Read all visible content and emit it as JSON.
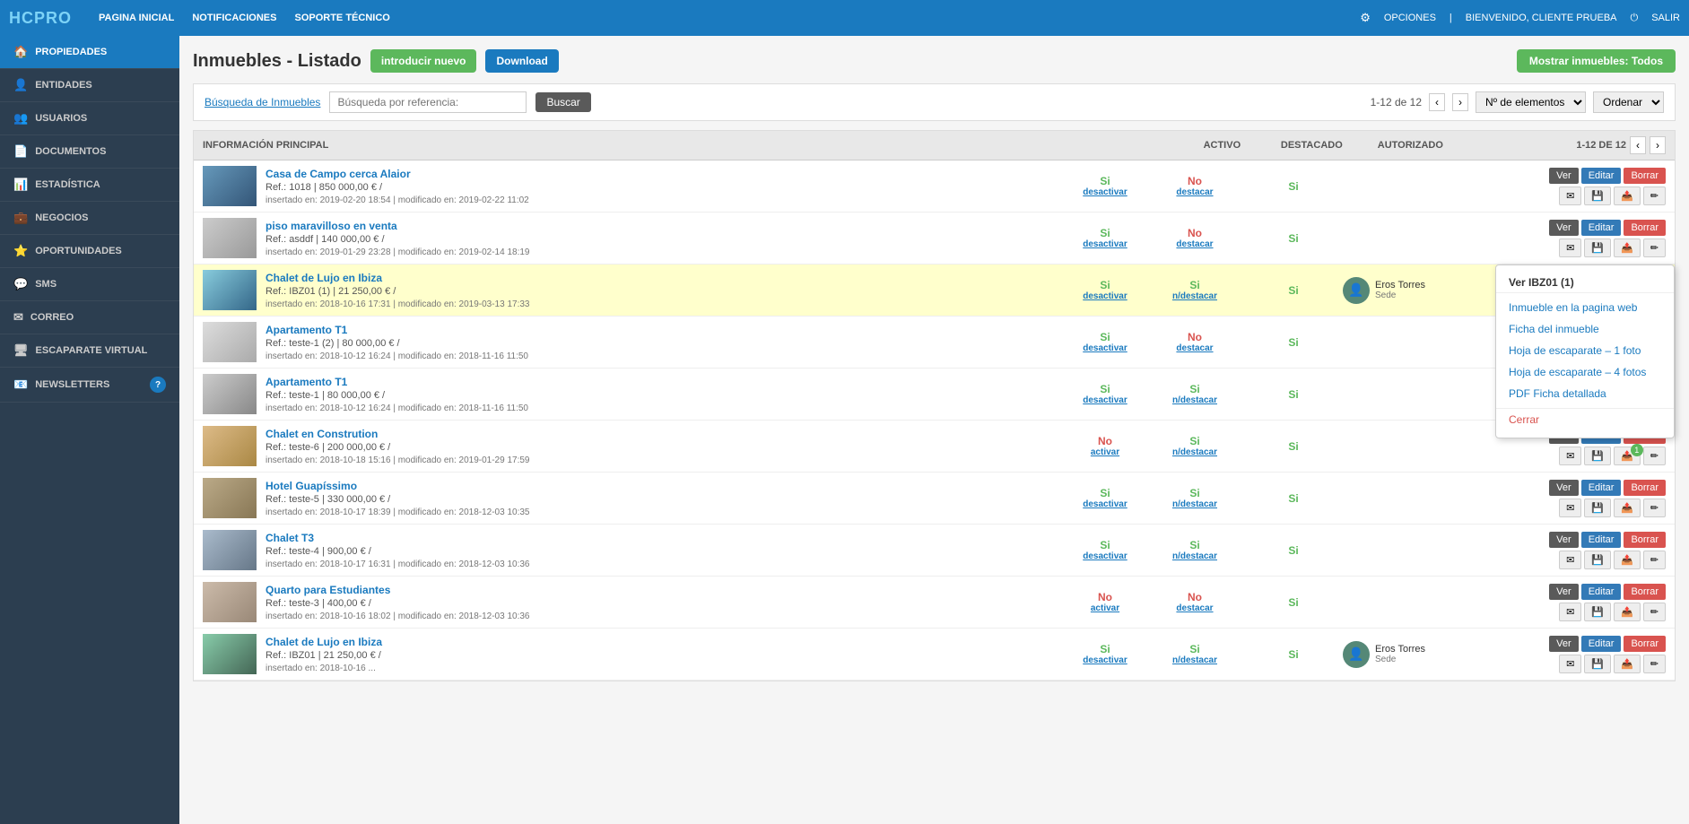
{
  "topnav": {
    "logo_hc": "HC",
    "logo_pro": "PRO",
    "links": [
      "PAGINA INICIAL",
      "NOTIFICACIONES",
      "SOPORTE TÉCNICO"
    ],
    "opciones": "OPCIONES",
    "bienvenido": "BIENVENIDO, CLIENTE PRUEBA",
    "salir": "SALIR"
  },
  "sidebar": {
    "items": [
      {
        "label": "PROPIEDADES",
        "icon": "🏠",
        "active": true
      },
      {
        "label": "ENTIDADES",
        "icon": "👤"
      },
      {
        "label": "USUARIOS",
        "icon": "👥"
      },
      {
        "label": "DOCUMENTOS",
        "icon": "📄"
      },
      {
        "label": "ESTADÍSTICA",
        "icon": "📊"
      },
      {
        "label": "NEGOCIOS",
        "icon": "💼"
      },
      {
        "label": "OPORTUNIDADES",
        "icon": "⭐"
      },
      {
        "label": "SMS",
        "icon": "💬"
      },
      {
        "label": "CORREO",
        "icon": "✉"
      },
      {
        "label": "ESCAPARATE VIRTUAL",
        "icon": "🖥"
      },
      {
        "label": "NEWSLETTERS",
        "icon": "📧",
        "badge": "?"
      }
    ]
  },
  "page": {
    "title": "Inmuebles - Listado",
    "btn_nuevo": "introducir nuevo",
    "btn_download": "Download",
    "btn_mostrar": "Mostrar inmuebles: Todos"
  },
  "search": {
    "link_label": "Búsqueda de Inmuebles",
    "input_placeholder": "Búsqueda por referencia:",
    "btn_buscar": "Buscar",
    "pagination_info": "1-12 de 12",
    "elements_label": "Nº de elementos",
    "order_label": "Ordenar"
  },
  "table": {
    "headers": {
      "info": "INFORMACIÓN PRINCIPAL",
      "activo": "ACTIVO",
      "destacado": "DESTACADO",
      "autorizado": "AUTORIZADO"
    },
    "pagination_top": "1-12 de 12",
    "rows": [
      {
        "name": "Casa de Campo cerca Alaior",
        "ref": "Ref.: 1018 | 850 000,00 € /",
        "date": "insertado en: 2019-02-20 18:54 | modificado en: 2019-02-22 11:02",
        "activo": "Si",
        "activo_link": "desactivar",
        "destacado": "No",
        "destacado_link": "destacar",
        "autorizado": "Si",
        "agent": null,
        "color": "blue",
        "highlighted": false
      },
      {
        "name": "piso maravilloso en venta",
        "ref": "Ref.: asddf | 140 000,00 € /",
        "date": "insertado en: 2019-01-29 23:28 | modificado en: 2019-02-14 18:19",
        "activo": "Si",
        "activo_link": "desactivar",
        "destacado": "No",
        "destacado_link": "destacar",
        "autorizado": "Si",
        "agent": null,
        "color": "gray",
        "highlighted": false
      },
      {
        "name": "Chalet de Lujo en Ibiza",
        "ref": "Ref.: IBZ01 (1) | 21 250,00 € /",
        "date": "insertado en: 2018-10-16 17:31 | modificado en: 2019-03-13 17:33",
        "activo": "Si",
        "activo_link": "desactivar",
        "destacado": "Si",
        "destacado_link": "n/destacar",
        "autorizado": "Si",
        "agent": {
          "name": "Eros Torres",
          "role": "Sede"
        },
        "color": "teal",
        "highlighted": true,
        "showDropdown": true,
        "dropdown": {
          "title": "Ver IBZ01 (1)",
          "links": [
            "Inmueble en la pagina web",
            "Ficha del inmueble",
            "Hoja de escaparate – 1 foto",
            "Hoja de escaparate – 4 fotos",
            "PDF Ficha detallada"
          ],
          "close": "Cerrar"
        }
      },
      {
        "name": "Apartamento T1",
        "ref": "Ref.: teste-1 (2) | 80 000,00 € /",
        "date": "insertado en: 2018-10-12 16:24 | modificado en: 2018-11-16 11:50",
        "activo": "Si",
        "activo_link": "desactivar",
        "destacado": "No",
        "destacado_link": "destacar",
        "autorizado": "Si",
        "agent": null,
        "color": "lightgray",
        "highlighted": false
      },
      {
        "name": "Apartamento T1",
        "ref": "Ref.: teste-1 | 80 000,00 € /",
        "date": "insertado en: 2018-10-12 16:24 | modificado en: 2018-11-16 11:50",
        "activo": "Si",
        "activo_link": "desactivar",
        "destacado": "Si",
        "destacado_link": "n/destacar",
        "autorizado": "Si",
        "agent": null,
        "color": "lightgray2",
        "highlighted": false
      },
      {
        "name": "Chalet en Constrution",
        "ref": "Ref.: teste-6 | 200 000,00 € /",
        "date": "insertado en: 2018-10-18 15:16 | modificado en: 2019-01-29 17:59",
        "activo": "No",
        "activo_link": "activar",
        "destacado": "Si",
        "destacado_link": "n/destacar",
        "autorizado": "Si",
        "agent": null,
        "color": "orange",
        "highlighted": false,
        "has_badge": true
      },
      {
        "name": "Hotel Guapíssimo",
        "ref": "Ref.: teste-5 | 330 000,00 € /",
        "date": "insertado en: 2018-10-17 18:39 | modificado en: 2018-12-03 10:35",
        "activo": "Si",
        "activo_link": "desactivar",
        "destacado": "Si",
        "destacado_link": "n/destacar",
        "autorizado": "Si",
        "agent": null,
        "color": "brown",
        "highlighted": false
      },
      {
        "name": "Chalet T3",
        "ref": "Ref.: teste-4 | 900,00 € /",
        "date": "insertado en: 2018-10-17 16:31 | modificado en: 2018-12-03 10:36",
        "activo": "Si",
        "activo_link": "desactivar",
        "destacado": "Si",
        "destacado_link": "n/destacar",
        "autorizado": "Si",
        "agent": null,
        "color": "darkgray",
        "highlighted": false
      },
      {
        "name": "Quarto para Estudiantes",
        "ref": "Ref.: teste-3 | 400,00 € /",
        "date": "insertado en: 2018-10-16 18:02 | modificado en: 2018-12-03 10:36",
        "activo": "No",
        "activo_link": "activar",
        "destacado": "No",
        "destacado_link": "destacar",
        "autorizado": "Si",
        "agent": null,
        "color": "tan",
        "highlighted": false
      },
      {
        "name": "Chalet de Lujo en Ibiza",
        "ref": "Ref.: IBZ01 | 21 250,00 € /",
        "date": "insertado en: 2018-10-16 ...",
        "activo": "Si",
        "activo_link": "desactivar",
        "destacado": "Si",
        "destacado_link": "n/destacar",
        "autorizado": "Si",
        "agent": {
          "name": "Eros Torres",
          "role": "Sede"
        },
        "color": "teal2",
        "highlighted": false
      }
    ]
  }
}
